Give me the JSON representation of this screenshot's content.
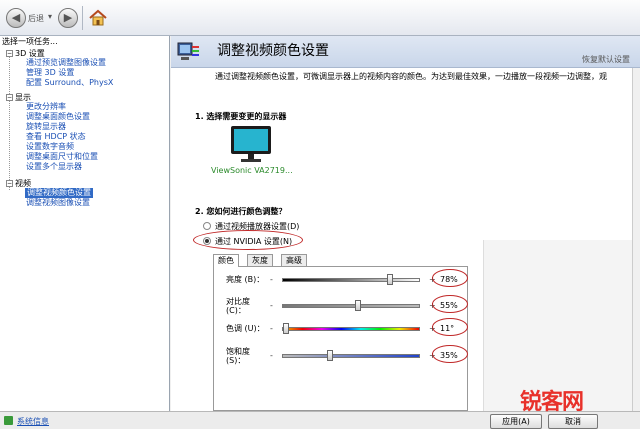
{
  "toolbar": {
    "back_label": "后退"
  },
  "sidebar": {
    "title": "选择一项任务...",
    "categories": [
      {
        "label": "3D 设置",
        "items": [
          "通过预览调整图像设置",
          "管理 3D 设置",
          "配置 Surround、PhysX"
        ]
      },
      {
        "label": "显示",
        "items": [
          "更改分辨率",
          "调整桌面颜色设置",
          "旋转显示器",
          "查看 HDCP 状态",
          "设置数字音频",
          "调整桌面尺寸和位置",
          "设置多个显示器"
        ]
      },
      {
        "label": "视频",
        "items": [
          "调整视频颜色设置",
          "调整视频图像设置"
        ]
      }
    ],
    "selected_item": "调整视频颜色设置"
  },
  "main": {
    "title": "调整视频颜色设置",
    "restore_defaults": "恢复默认设置",
    "description": "通过调整视频颜色设置，可微调显示器上的视频内容的颜色。为达到最佳效果，一边播放一段视频一边调整，观",
    "section1_title": "1. 选择需要变更的显示器",
    "monitor_label": "ViewSonic VA2719...",
    "section2_title": "2. 您如何进行颜色调整？",
    "radio_player": "通过视频播放器设置(D)",
    "radio_nvidia": "通过 NVIDIA 设置(N)",
    "tabs": [
      "颜色",
      "灰度",
      "高级"
    ],
    "sliders": [
      {
        "label": "亮度 (B)：",
        "value_text": "78%",
        "level": 0.78
      },
      {
        "label": "对比度 (C)：",
        "value_text": "55%",
        "level": 0.55
      },
      {
        "label": "色调 (U)：",
        "value_text": "11°",
        "level": 0.03
      },
      {
        "label": "饱和度 (S)：",
        "value_text": "35%",
        "level": 0.35
      }
    ],
    "minus_symbol": "-",
    "plus_symbol": "+"
  },
  "status": {
    "system_info": "系统信息",
    "apply_button": "应用(A)",
    "cancel_button": "取消"
  },
  "watermark": {
    "text": "锐客网"
  }
}
